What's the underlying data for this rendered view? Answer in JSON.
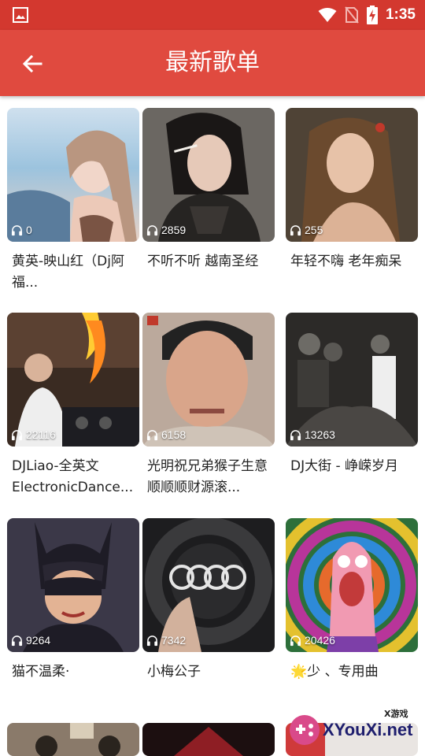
{
  "status_bar": {
    "time": "1:35",
    "icons": [
      "gallery-icon",
      "wifi-icon",
      "no-sim-icon",
      "battery-charging-icon"
    ]
  },
  "app_bar": {
    "title": "最新歌单",
    "back_icon": "arrow-back-icon"
  },
  "colors": {
    "status_bar": "#d3382f",
    "app_bar": "#e04a3f"
  },
  "playlists": [
    {
      "plays": "0",
      "name": "黄英-映山红（Dj阿福...",
      "cover": "woman-beach-portrait"
    },
    {
      "plays": "2859",
      "name": "不听不听 越南圣经",
      "cover": "woman-smoking-portrait"
    },
    {
      "plays": "255",
      "name": "年轻不嗨 老年痴呆",
      "cover": "woman-flower-portrait"
    },
    {
      "plays": "22116",
      "name": "DJLiao-全英文ElectronicDance...",
      "cover": "dj-fire-stage"
    },
    {
      "plays": "6158",
      "name": "光明祝兄弟猴子生意顺顺顺财源滚...",
      "cover": "man-selfie-youdianliao"
    },
    {
      "plays": "13263",
      "name": "DJ大街 - 峥嵘岁月",
      "cover": "crowd-night-party"
    },
    {
      "plays": "9264",
      "name": "猫不温柔·",
      "cover": "batgirl-cartoon"
    },
    {
      "plays": "7342",
      "name": "小梅公子",
      "cover": "audi-steering-wheel"
    },
    {
      "plays": "20426",
      "name": "🌟少 、专用曲",
      "cover": "psychedelic-starfish"
    },
    {
      "plays": "",
      "name": "",
      "cover": "partial-row"
    },
    {
      "plays": "",
      "name": "",
      "cover": "partial-row"
    },
    {
      "plays": "",
      "name": "",
      "cover": "partial-row"
    }
  ],
  "watermark": {
    "brand": "XYouXi.net",
    "small": "X游戏"
  }
}
